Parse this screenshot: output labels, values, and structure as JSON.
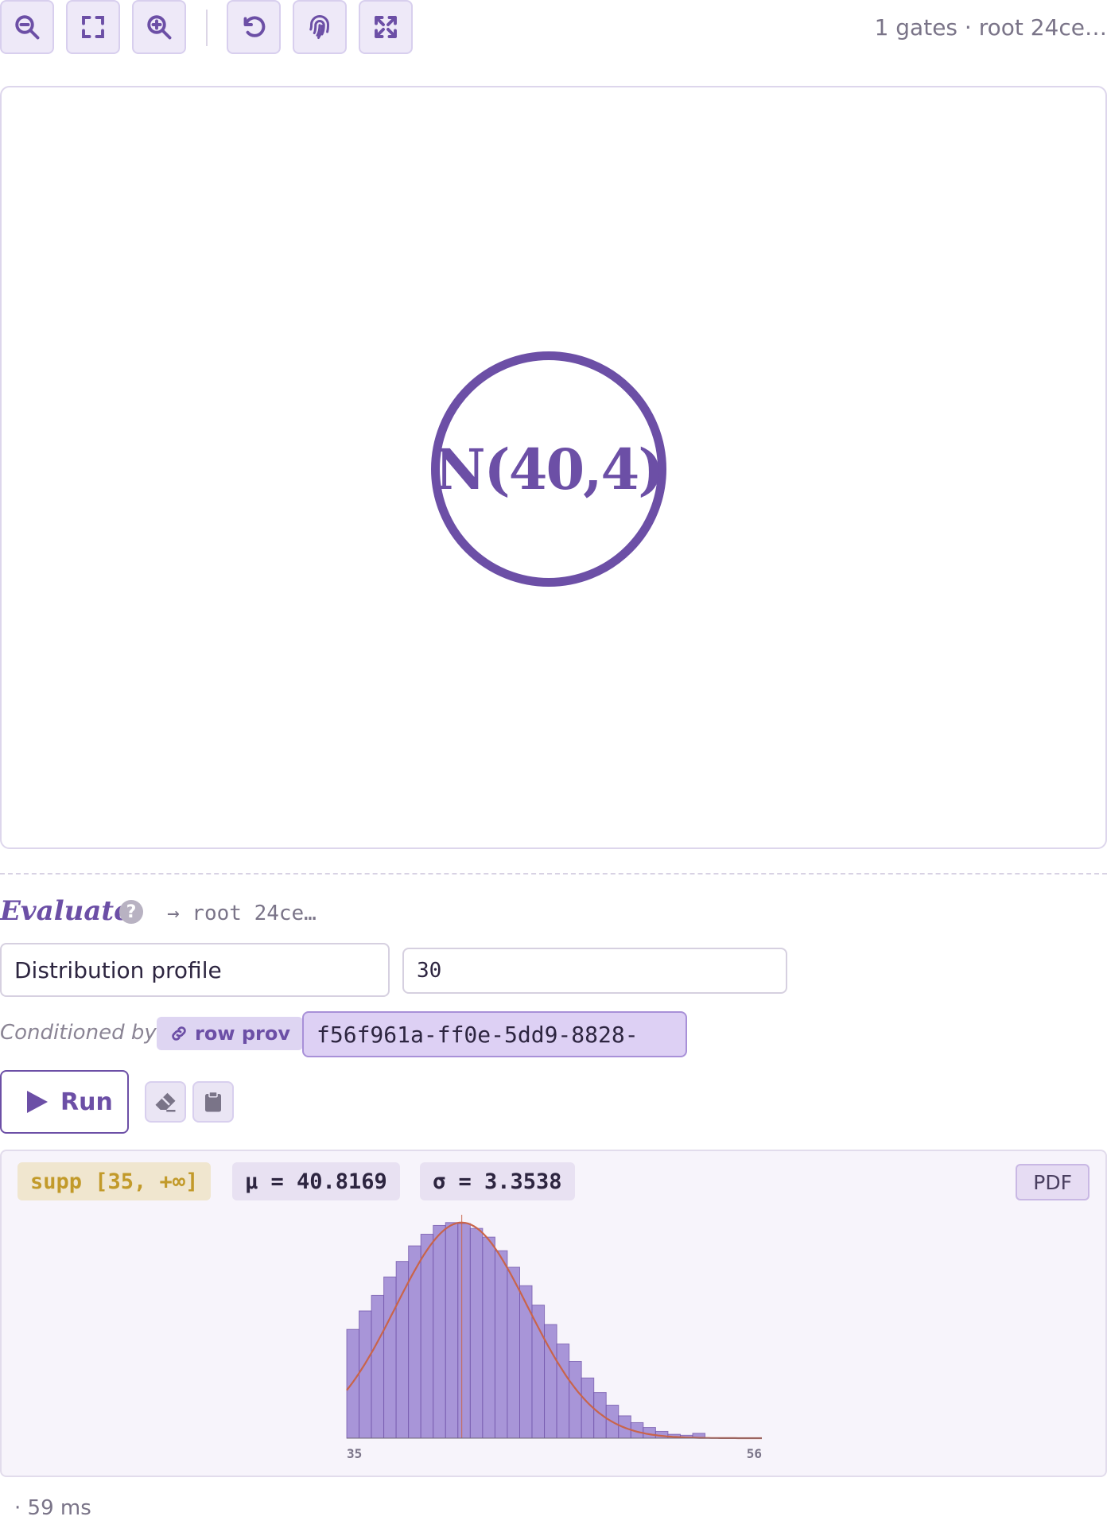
{
  "toolbar": {
    "buttons": [
      {
        "icon": "zoom-out-icon"
      },
      {
        "icon": "fit-screen-icon"
      },
      {
        "icon": "zoom-in-icon"
      },
      {
        "icon": "undo-icon"
      },
      {
        "icon": "fingerprint-icon"
      },
      {
        "icon": "expand-icon"
      }
    ],
    "info": "1 gates · root 24ce…"
  },
  "graph": {
    "gate_label": "N(40,4)"
  },
  "evaluate": {
    "title": "Evaluate",
    "help": "?",
    "root": "→ root 24ce…",
    "mode": "Distribution profile",
    "samples": "30",
    "conditioned_label": "Conditioned by:",
    "row_prov": "row prov",
    "uuid": "f56f961a-ff0e-5dd9-8828-",
    "run_label": "Run"
  },
  "result": {
    "support": "supp [35, +∞]",
    "mean": "μ = 40.8169",
    "sigma": "σ = 3.3538",
    "view": "PDF",
    "timing": "· 59 ms"
  },
  "colors": {
    "accent": "#6c4fa6",
    "bar_fill": "#a895d8",
    "curve": "#c9644a",
    "support_chip": "#c29a2a"
  },
  "chart_data": {
    "type": "bar",
    "x_min": 35,
    "x_max": 56,
    "tick_labels": [
      "35",
      "56"
    ],
    "bin_width": 0.625,
    "bin_starts": [
      35,
      35.625,
      36.25,
      36.875,
      37.5,
      38.125,
      38.75,
      39.375,
      40,
      40.625,
      41.25,
      41.875,
      42.5,
      43.125,
      43.75,
      44.375,
      45,
      45.625,
      46.25,
      46.875,
      47.5,
      48.125,
      48.75,
      49.375,
      50,
      50.625,
      51.25,
      51.875,
      52.5
    ],
    "values": [
      0.112,
      0.131,
      0.147,
      0.166,
      0.182,
      0.198,
      0.21,
      0.219,
      0.222,
      0.221,
      0.216,
      0.207,
      0.193,
      0.176,
      0.157,
      0.137,
      0.117,
      0.097,
      0.079,
      0.062,
      0.047,
      0.034,
      0.023,
      0.016,
      0.011,
      0.007,
      0.004,
      0.003,
      0.005
    ],
    "curve": "PDF",
    "mean": 40.8169,
    "sigma": 3.3538,
    "ylim": [
      0,
      0.23
    ]
  }
}
